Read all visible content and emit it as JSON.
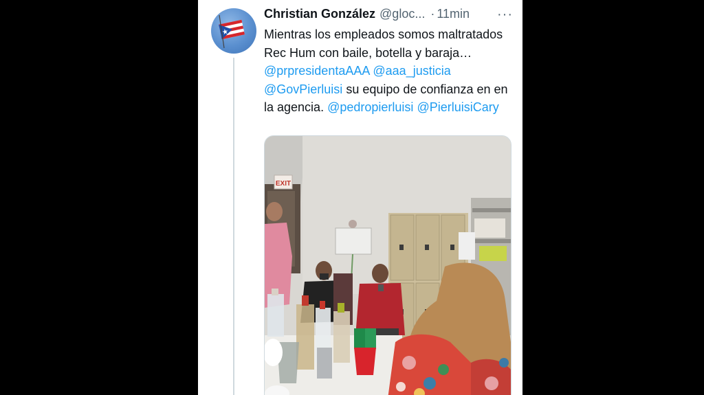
{
  "tweet": {
    "author_name": "Christian González",
    "author_handle": "@gloc...",
    "separator": "·",
    "time": "11min",
    "more_icon": "more-horizontal-icon",
    "text_parts": [
      "Mientras los empleados somos maltratados Rec Hum con baile, botella y baraja… ",
      "@prpresidentaAAA",
      " ",
      "@aaa_justicia",
      " ",
      "@GovPierluisi",
      " su equipo de confianza en en la agencia. ",
      "@pedropierluisi",
      " ",
      "@PierluisiCary"
    ]
  },
  "photo": {
    "exit_sign": "EXIT"
  },
  "colors": {
    "mention": "#1d9bf0",
    "text": "#0f1419",
    "secondary": "#536471",
    "background": "#000000",
    "card": "#ffffff"
  }
}
